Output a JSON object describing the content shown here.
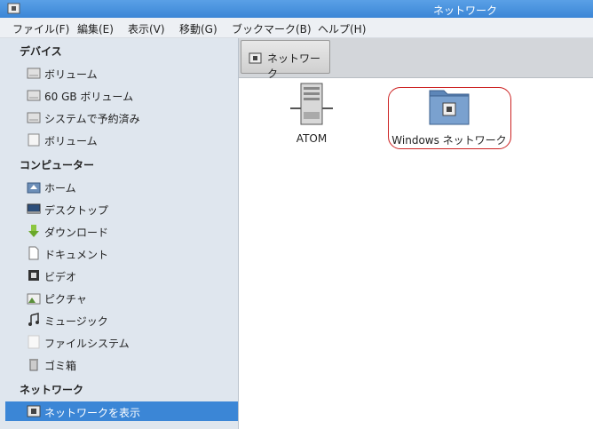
{
  "window": {
    "title": "ネットワーク"
  },
  "menu": [
    {
      "label": "ファイル(F)"
    },
    {
      "label": "編集(E)"
    },
    {
      "label": "表示(V)"
    },
    {
      "label": "移動(G)"
    },
    {
      "label": "ブックマーク(B)"
    },
    {
      "label": "ヘルプ(H)"
    }
  ],
  "sidebar": {
    "devices_header": "デバイス",
    "devices": [
      {
        "label": "ボリューム"
      },
      {
        "label": "60 GB ボリューム"
      },
      {
        "label": "システムで予約済み"
      },
      {
        "label": "ボリューム"
      }
    ],
    "computer_header": "コンピューター",
    "computer": [
      {
        "label": "ホーム"
      },
      {
        "label": "デスクトップ"
      },
      {
        "label": "ダウンロード"
      },
      {
        "label": "ドキュメント"
      },
      {
        "label": "ビデオ"
      },
      {
        "label": "ピクチャ"
      },
      {
        "label": "ミュージック"
      },
      {
        "label": "ファイルシステム"
      },
      {
        "label": "ゴミ箱"
      }
    ],
    "network_header": "ネットワーク",
    "network": [
      {
        "label": "ネットワークを表示"
      }
    ]
  },
  "pathbar": {
    "crumb": "ネットワーク"
  },
  "content": {
    "items": [
      {
        "label": "ATOM",
        "icon": "server-icon"
      },
      {
        "label": "Windows ネットワーク",
        "icon": "network-folder-icon"
      }
    ]
  },
  "colors": {
    "accent": "#3b86d6",
    "highlight": "#cc2222"
  }
}
